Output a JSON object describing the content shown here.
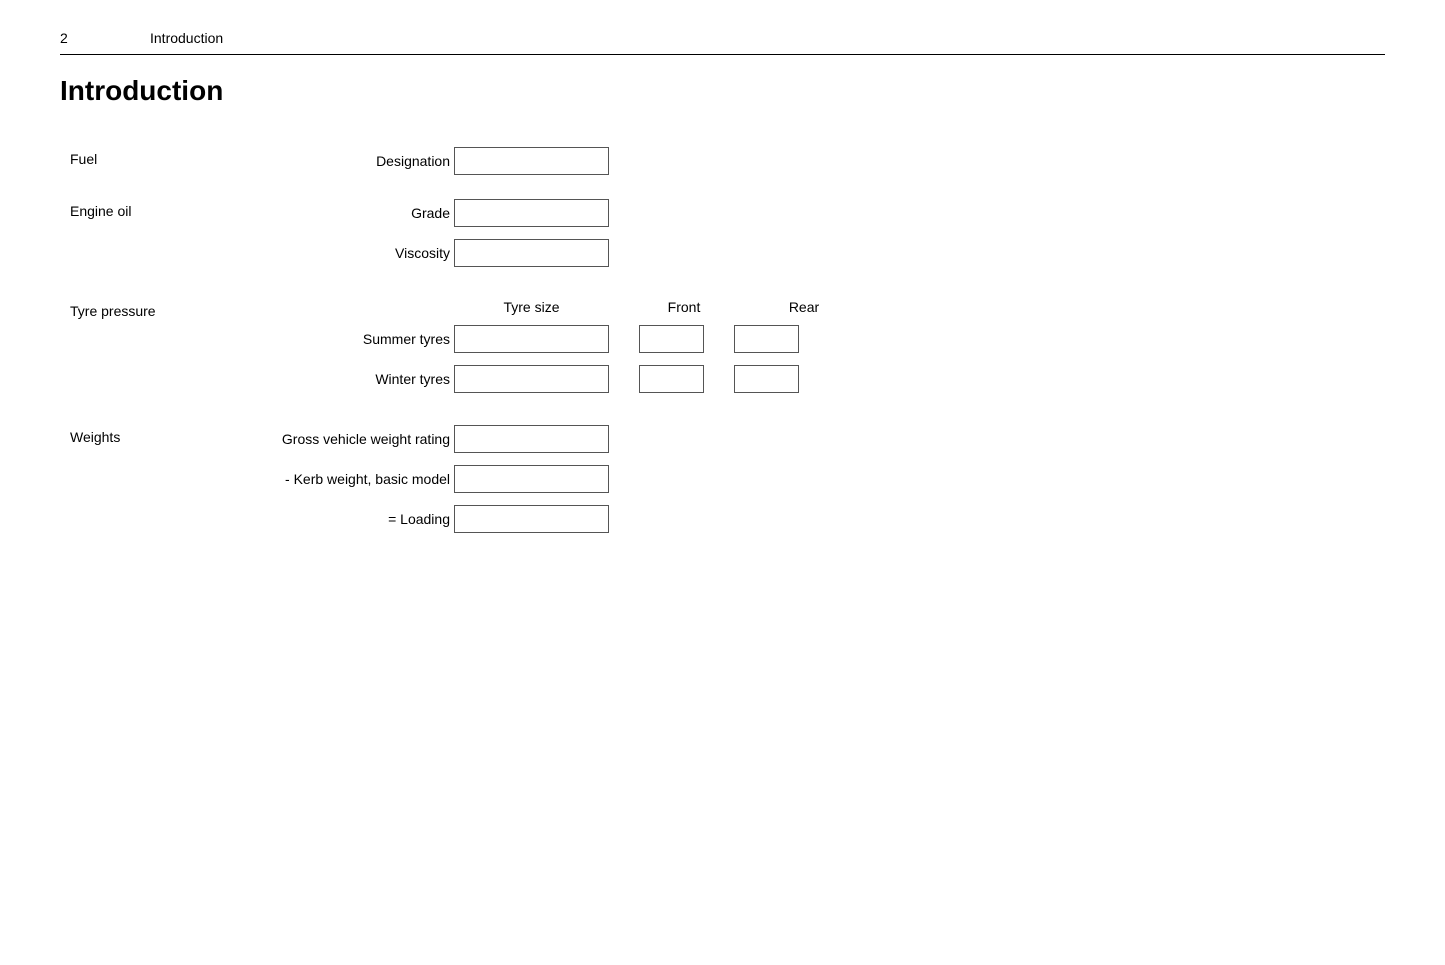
{
  "header": {
    "page_number": "2",
    "title": "Introduction"
  },
  "page_title": "Introduction",
  "sections": {
    "fuel": {
      "label": "Fuel",
      "fields": [
        {
          "label": "Designation",
          "value": ""
        }
      ]
    },
    "engine_oil": {
      "label": "Engine oil",
      "fields": [
        {
          "label": "Grade",
          "value": ""
        },
        {
          "label": "Viscosity",
          "value": ""
        }
      ]
    },
    "tyre_pressure": {
      "label": "Tyre pressure",
      "col_headers": {
        "tyre_size": "Tyre size",
        "front": "Front",
        "rear": "Rear"
      },
      "rows": [
        {
          "label": "Summer tyres"
        },
        {
          "label": "Winter tyres"
        }
      ]
    },
    "weights": {
      "label": "Weights",
      "fields": [
        {
          "label": "Gross vehicle weight rating",
          "value": ""
        },
        {
          "label": "- Kerb weight, basic model",
          "value": ""
        },
        {
          "label": "= Loading",
          "value": ""
        }
      ]
    }
  }
}
